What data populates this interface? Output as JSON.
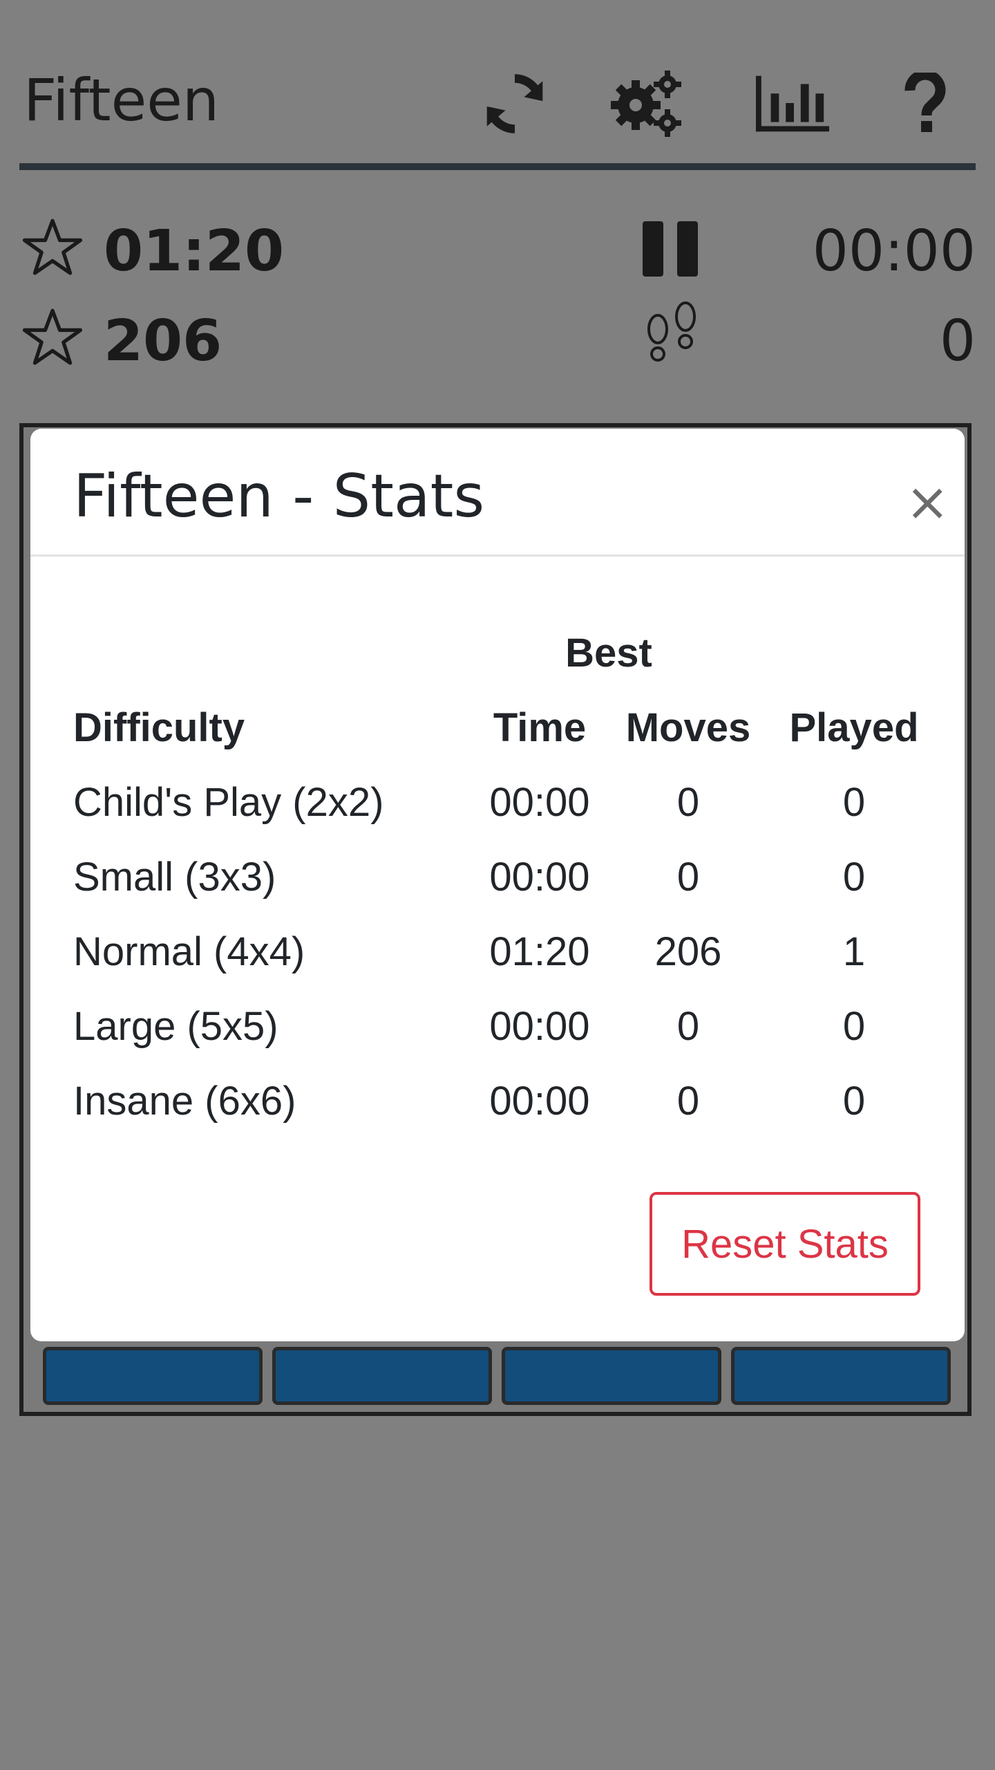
{
  "header": {
    "title": "Fifteen",
    "icons": [
      "refresh-icon",
      "gears-icon",
      "bar-chart-icon",
      "question-icon"
    ]
  },
  "status": {
    "best_time": "01:20",
    "best_moves": "206",
    "current_time": "00:00",
    "current_moves": "0",
    "icons": [
      "star-icon",
      "pause-icon",
      "footprints-icon"
    ]
  },
  "modal": {
    "title": "Fifteen - Stats",
    "close_label": "×",
    "group_header": "Best",
    "columns": [
      "Difficulty",
      "Time",
      "Moves",
      "Played"
    ],
    "rows": [
      {
        "difficulty": "Child's Play (2x2)",
        "time": "00:00",
        "moves": "0",
        "played": "0"
      },
      {
        "difficulty": "Small (3x3)",
        "time": "00:00",
        "moves": "0",
        "played": "0"
      },
      {
        "difficulty": "Normal (4x4)",
        "time": "01:20",
        "moves": "206",
        "played": "1"
      },
      {
        "difficulty": "Large (5x5)",
        "time": "00:00",
        "moves": "0",
        "played": "0"
      },
      {
        "difficulty": "Insane (6x6)",
        "time": "00:00",
        "moves": "0",
        "played": "0"
      }
    ],
    "reset_label": "Reset Stats"
  },
  "colors": {
    "overlay": "#808080",
    "tile": "#124d7c",
    "danger": "#dc3545",
    "divider": "#2b333a"
  }
}
